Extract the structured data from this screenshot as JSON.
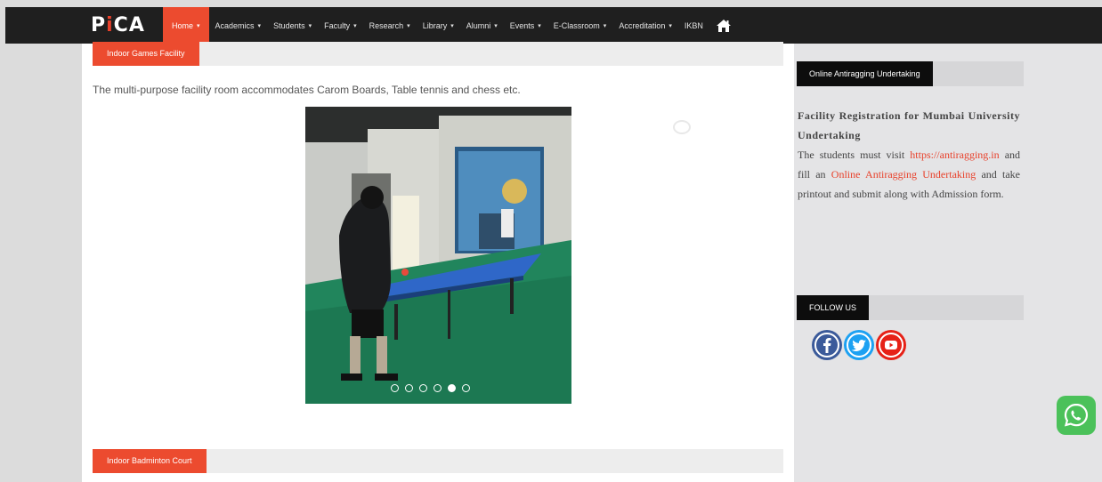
{
  "brand": {
    "logo_p": "P",
    "logo_i": "i",
    "logo_ca": "CA"
  },
  "nav": {
    "items": [
      {
        "label": "Home",
        "active": true
      },
      {
        "label": "Academics"
      },
      {
        "label": "Students"
      },
      {
        "label": "Faculty"
      },
      {
        "label": "Research"
      },
      {
        "label": "Library"
      },
      {
        "label": "Alumni"
      },
      {
        "label": "Events"
      },
      {
        "label": "E-Classroom"
      },
      {
        "label": "Accreditation"
      },
      {
        "label": "IKBN"
      }
    ],
    "home_icon": "home-icon",
    "caret": "▾"
  },
  "main": {
    "section1_title": "Indoor Games Facility",
    "description": "The multi-purpose facility room accommodates Carom Boards, Table tennis and chess etc.",
    "slider_dots": 6,
    "active_dot": 5,
    "section2_title": "Indoor Badminton Court"
  },
  "sidebar": {
    "antiragging_title": "Online Antiragging Undertaking",
    "facility_heading": "Facility Registration for Mumbai University Undertaking",
    "text_1": "The students must visit",
    "link_1": "https://antiragging.in",
    "text_2": "and fill an",
    "link_2": "Online Antiragging Undertaking",
    "text_3": "and take printout and submit along with Admission form.",
    "follow_title": "FOLLOW US",
    "social": [
      "facebook-icon",
      "twitter-icon",
      "youtube-icon"
    ]
  },
  "colors": {
    "accent": "#ec4b2f",
    "topbar": "#1f1f1f",
    "facebook": "#3b5a9a",
    "twitter": "#1da1f2",
    "youtube": "#e62117",
    "whatsapp": "#4bc15a"
  }
}
